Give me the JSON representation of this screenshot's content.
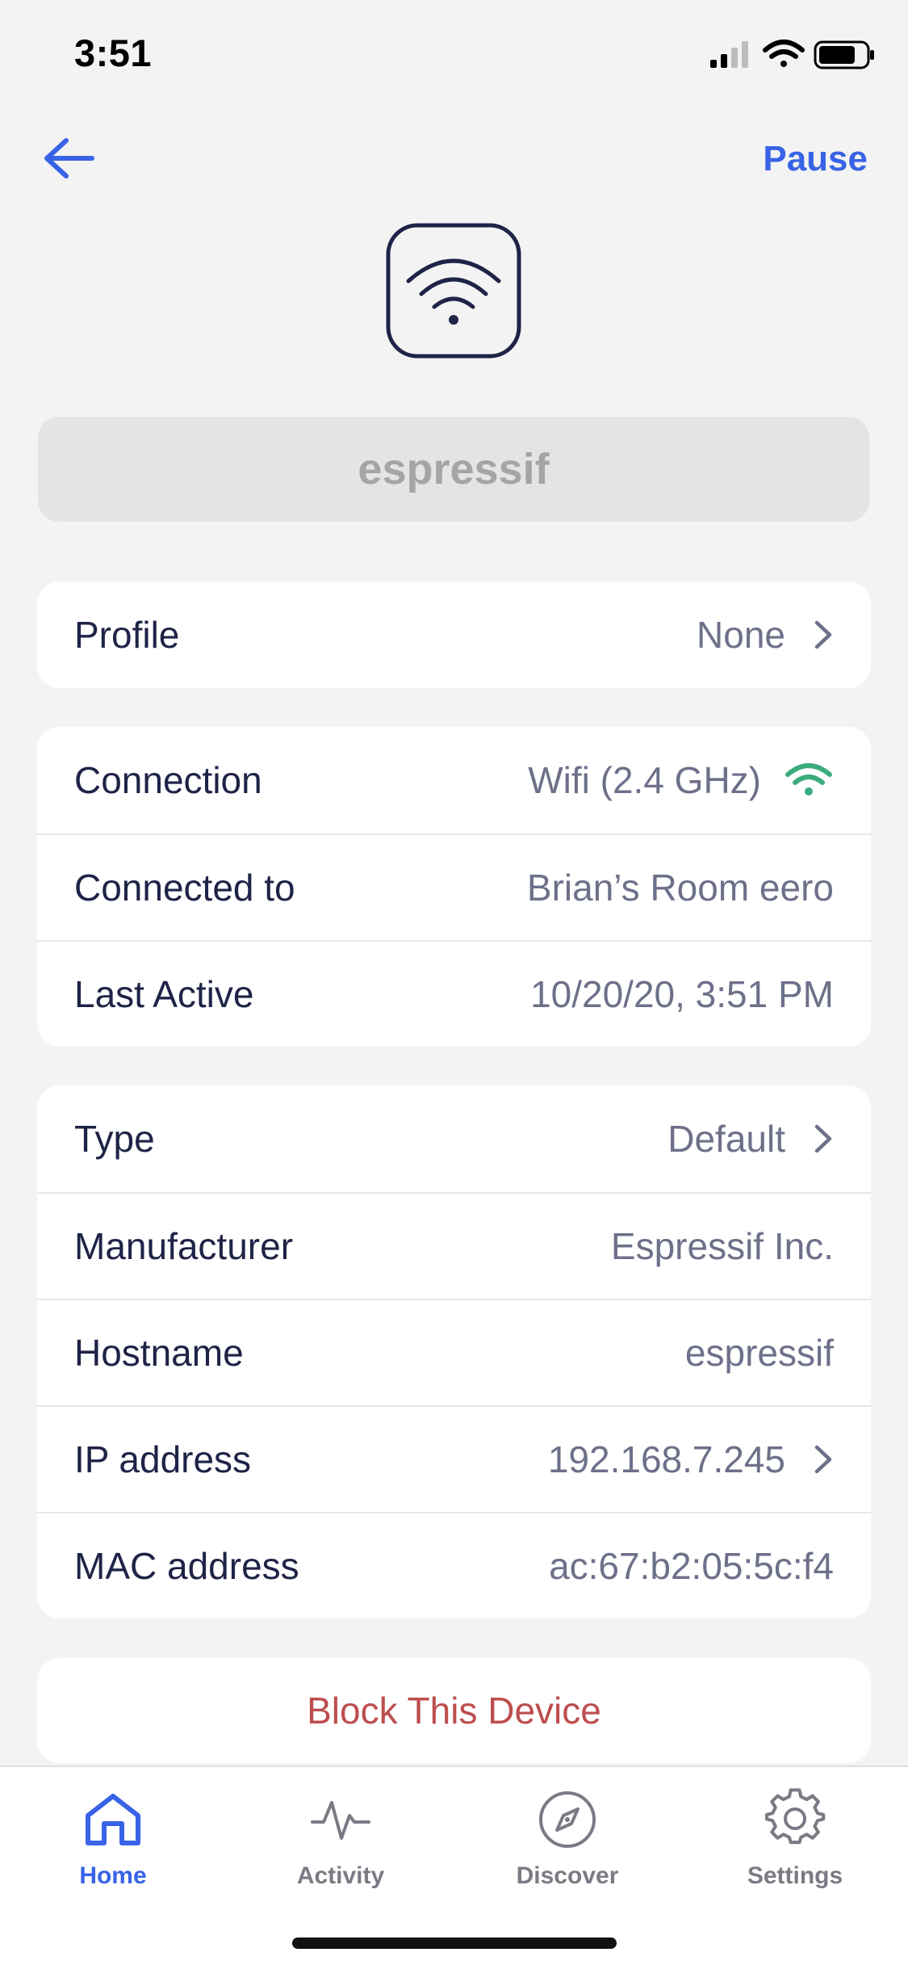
{
  "status_bar": {
    "time": "3:51"
  },
  "nav": {
    "pause_label": "Pause"
  },
  "device": {
    "name": "espressif"
  },
  "profile_card": {
    "label": "Profile",
    "value": "None"
  },
  "connection_card": [
    {
      "label": "Connection",
      "value": "Wifi (2.4 GHz)"
    },
    {
      "label": "Connected to",
      "value": "Brian’s Room eero"
    },
    {
      "label": "Last Active",
      "value": "10/20/20, 3:51 PM"
    }
  ],
  "details_card": [
    {
      "label": "Type",
      "value": "Default"
    },
    {
      "label": "Manufacturer",
      "value": "Espressif Inc."
    },
    {
      "label": "Hostname",
      "value": "espressif"
    },
    {
      "label": "IP address",
      "value": "192.168.7.245"
    },
    {
      "label": "MAC address",
      "value": "ac:67:b2:05:5c:f4"
    }
  ],
  "block_label": "Block This Device",
  "tabs": [
    {
      "label": "Home"
    },
    {
      "label": "Activity"
    },
    {
      "label": "Discover"
    },
    {
      "label": "Settings"
    }
  ],
  "colors": {
    "accent": "#3863e6",
    "wifi_green": "#3bab7d",
    "danger": "#bd4e4e",
    "text": "#1f2347"
  },
  "icons": [
    "back-arrow-icon",
    "wifi-device-icon",
    "chevron-right-icon",
    "home-icon",
    "activity-icon",
    "compass-icon",
    "gear-icon"
  ]
}
